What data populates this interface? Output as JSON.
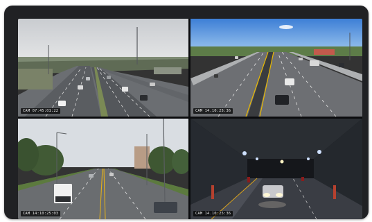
{
  "feeds": [
    {
      "timestamp": "CAM 07:45:01:22"
    },
    {
      "timestamp": "CAM 14.10:25:36"
    },
    {
      "timestamp": "CAM 14:10:25:03"
    },
    {
      "timestamp": "CAM 14.10:25:36"
    }
  ]
}
